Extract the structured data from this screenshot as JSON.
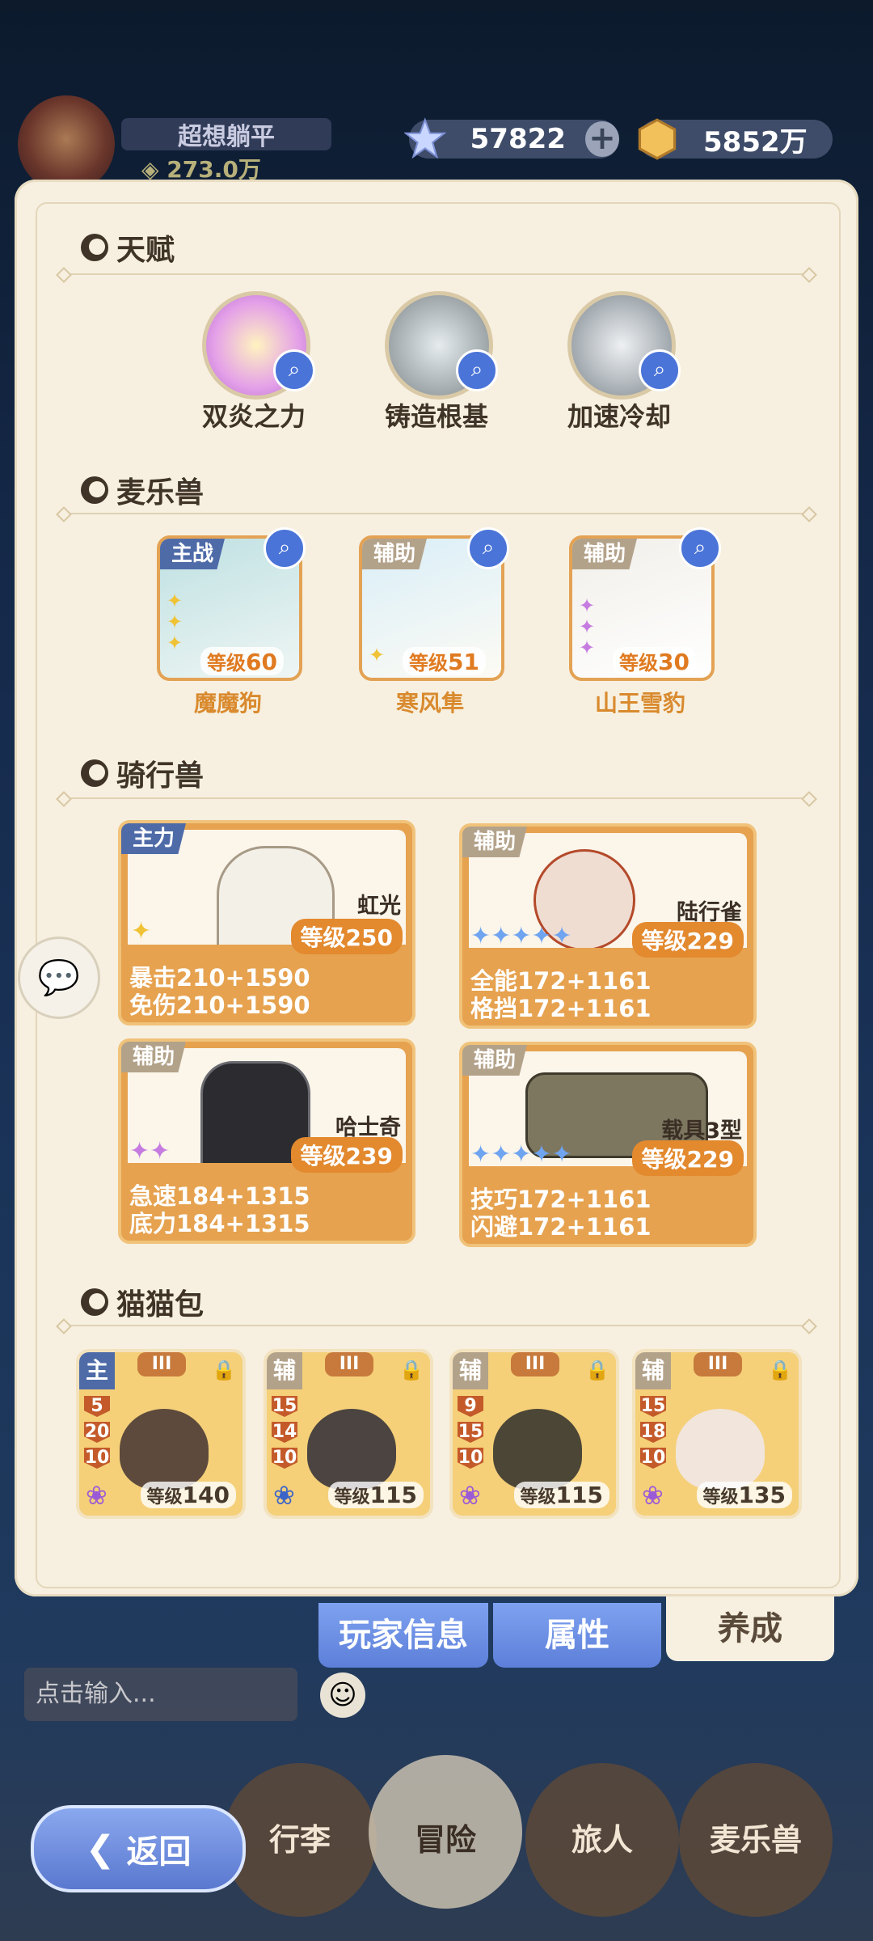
{
  "header": {
    "profile": {
      "name": "超想躺平",
      "power": "273.0万"
    },
    "currency": {
      "gems": "57822",
      "coins": "5852万"
    }
  },
  "sections": {
    "talent": "天赋",
    "pet": "麦乐兽",
    "mount": "骑行兽",
    "cat": "猫猫包"
  },
  "talents": [
    {
      "name": "双炎之力",
      "icon": "dual-flame-icon",
      "color": "#d69ae0"
    },
    {
      "name": "铸造根基",
      "icon": "sword-icon",
      "color": "#9aa3a6"
    },
    {
      "name": "加速冷却",
      "icon": "fist-icon",
      "color": "#9ca4ab"
    }
  ],
  "pets": [
    {
      "tag": "主战",
      "name": "魔魔狗",
      "level_label": "等级",
      "level": "60"
    },
    {
      "tag": "辅助",
      "name": "寒风隼",
      "level_label": "等级",
      "level": "51"
    },
    {
      "tag": "辅助",
      "name": "山王雪豹",
      "level_label": "等级",
      "level": "30"
    }
  ],
  "mounts": [
    {
      "tag": "主力",
      "name": "虹光",
      "level": "等级250",
      "stats": [
        "暴击210+1590",
        "免伤210+1590"
      ]
    },
    {
      "tag": "辅助",
      "name": "陆行雀",
      "level": "等级229",
      "stats": [
        "全能172+1161",
        "格挡172+1161"
      ]
    },
    {
      "tag": "辅助",
      "name": "哈士奇",
      "level": "等级239",
      "stats": [
        "急速184+1315",
        "底力184+1315"
      ]
    },
    {
      "tag": "辅助",
      "name": "载具3型",
      "level": "等级229",
      "stats": [
        "技巧172+1161",
        "闪避172+1161"
      ]
    }
  ],
  "cats": [
    {
      "tag": "主",
      "rank": "III",
      "nums": [
        "5",
        "20",
        "10"
      ],
      "level_label": "等级",
      "level": "140"
    },
    {
      "tag": "辅",
      "rank": "III",
      "nums": [
        "15",
        "14",
        "10"
      ],
      "level_label": "等级",
      "level": "115"
    },
    {
      "tag": "辅",
      "rank": "III",
      "nums": [
        "9",
        "15",
        "10"
      ],
      "level_label": "等级",
      "level": "115"
    },
    {
      "tag": "辅",
      "rank": "III",
      "nums": [
        "15",
        "18",
        "10"
      ],
      "level_label": "等级",
      "level": "135"
    }
  ],
  "tabs": {
    "player_info": "玩家信息",
    "attributes": "属性",
    "training": "养成"
  },
  "chat": {
    "placeholder": "点击输入..."
  },
  "nav": {
    "luggage": "行李",
    "adventure": "冒险",
    "traveler": "旅人",
    "pets": "麦乐兽",
    "back": "返回"
  }
}
